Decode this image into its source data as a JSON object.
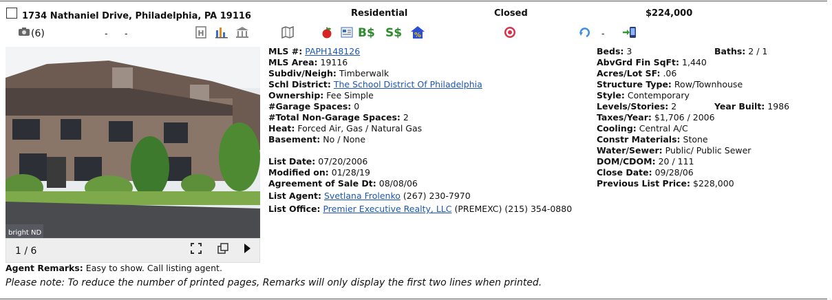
{
  "listing": {
    "address": "1734 Nathaniel Drive, Philadelphia, PA 19116",
    "type": "Residential",
    "status": "Closed",
    "price": "$224,000",
    "photo_count": "(6)",
    "dash1": "-",
    "dash2": "-",
    "dash3": "-"
  },
  "photo": {
    "counter": "1 / 6",
    "watermark": "bright ND"
  },
  "left": {
    "mls_label": "MLS #:",
    "mls_value": "PAPH148126",
    "area_label": "MLS Area:",
    "area_value": "19116",
    "subdiv_label": "Subdiv/Neigh:",
    "subdiv_value": "Timberwalk",
    "schl_label": "Schl District:",
    "schl_value": "The School District Of Philadelphia",
    "own_label": "Ownership:",
    "own_value": "Fee Simple",
    "garage_label": "#Garage Spaces:",
    "garage_value": "0",
    "nongarage_label": "#Total Non-Garage Spaces:",
    "nongarage_value": "2",
    "heat_label": "Heat:",
    "heat_value": "Forced Air, Gas / Natural Gas",
    "base_label": "Basement:",
    "base_value": "No / None",
    "listdate_label": "List Date:",
    "listdate_value": "07/20/2006",
    "mod_label": "Modified on:",
    "mod_value": "01/28/19",
    "aos_label": "Agreement of Sale Dt:",
    "aos_value": "08/08/06",
    "agent_label": "List Agent:",
    "agent_name": "Svetlana Frolenko",
    "agent_phone": "(267) 230-7970",
    "office_label": "List Office:",
    "office_name": "Premier Executive Realty, LLC",
    "office_rest": "(PREMEXC) (215) 354-0880"
  },
  "right": {
    "beds_label": "Beds:",
    "beds_value": "3",
    "baths_label": "Baths:",
    "baths_value": "2 / 1",
    "sqft_label": "AbvGrd Fin SqFt:",
    "sqft_value": "1,440",
    "acres_label": "Acres/Lot SF:",
    "acres_value": ".06",
    "struct_label": "Structure Type:",
    "struct_value": "Row/Townhouse",
    "style_label": "Style:",
    "style_value": "Contemporary",
    "levels_label": "Levels/Stories:",
    "levels_value": "2",
    "year_label": "Year Built:",
    "year_value": "1986",
    "taxes_label": "Taxes/Year:",
    "taxes_value": "$1,706 / 2006",
    "cool_label": "Cooling:",
    "cool_value": "Central A/C",
    "constr_label": "Constr Materials:",
    "constr_value": "Stone",
    "water_label": "Water/Sewer:",
    "water_value": "Public/ Public Sewer",
    "dom_label": "DOM/CDOM:",
    "dom_value": "20 / 111",
    "close_label": "Close Date:",
    "close_value": "09/28/06",
    "prev_label": "Previous List Price:",
    "prev_value": "$228,000"
  },
  "remarks": {
    "label": "Agent Remarks:",
    "value": "Easy to show. Call listing agent.",
    "note": "Please note: To reduce the number of printed pages, Remarks will only display the first two lines when printed."
  },
  "icons": {
    "bs": "B$",
    "ss": "S$"
  }
}
